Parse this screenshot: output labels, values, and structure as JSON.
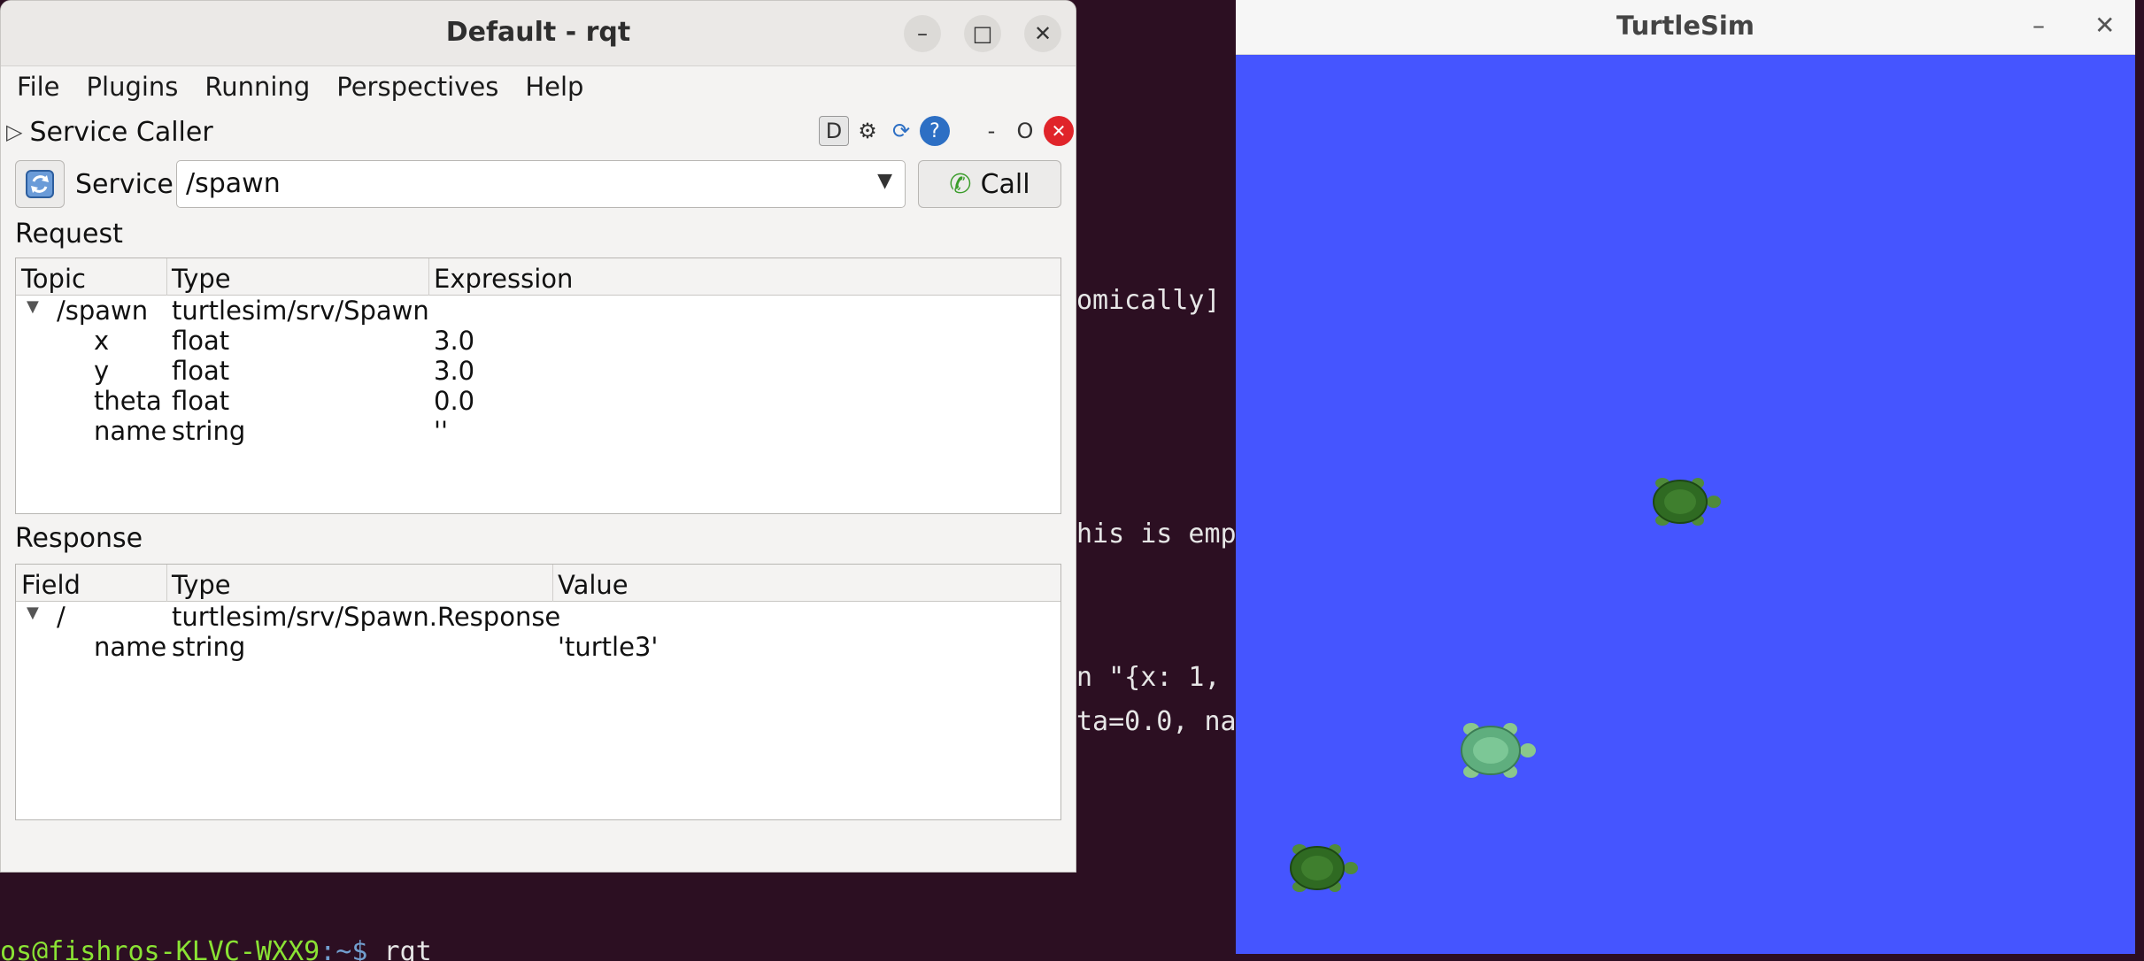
{
  "terminal": {
    "fragments": [
      "omically]",
      "his is emp",
      "n \"{x: 1,",
      "ta=0.0, na"
    ],
    "prompt_user": "os@fishros-KLVC-WXX9",
    "prompt_sep": ":~$",
    "prompt_cmd": " rqt"
  },
  "rqt": {
    "title": "Default - rqt",
    "menu": [
      {
        "label": "File"
      },
      {
        "label": "Plugins"
      },
      {
        "label": "Running"
      },
      {
        "label": "Perspectives"
      },
      {
        "label": "Help"
      }
    ],
    "plugin_title": "Service Caller",
    "plugin_tools": {
      "d": "D",
      "dash": "-",
      "o": "O"
    },
    "service_label": "Service",
    "service_value": "/spawn",
    "call_label": "Call",
    "request_label": "Request",
    "request_headers": [
      "Topic",
      "Type",
      "Expression"
    ],
    "request_rows": [
      {
        "topic": "/spawn",
        "type": "turtlesim/srv/Spawn",
        "expr": ""
      },
      {
        "topic": "x",
        "type": "float",
        "expr": "3.0"
      },
      {
        "topic": "y",
        "type": "float",
        "expr": "3.0"
      },
      {
        "topic": "theta",
        "type": "float",
        "expr": "0.0"
      },
      {
        "topic": "name",
        "type": "string",
        "expr": "''"
      }
    ],
    "response_label": "Response",
    "response_headers": [
      "Field",
      "Type",
      "Value"
    ],
    "response_rows": [
      {
        "field": "/",
        "type": "turtlesim/srv/Spawn.Response",
        "value": ""
      },
      {
        "field": "name",
        "type": "string",
        "value": "'turtle3'"
      }
    ]
  },
  "turtlesim": {
    "title": "TurtleSim",
    "background": "#4555ff"
  },
  "icons": {
    "refresh": "refresh-icon",
    "phone": "phone-icon",
    "gear": "gear-icon",
    "help": "help-icon"
  }
}
